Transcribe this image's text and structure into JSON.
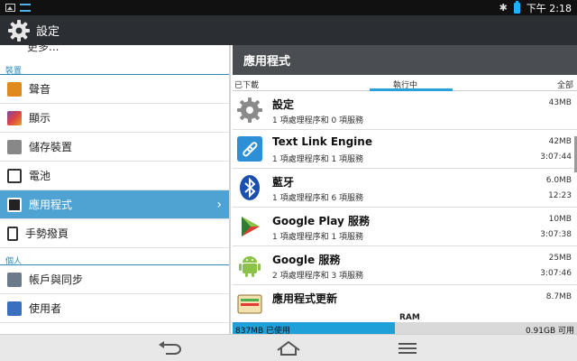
{
  "status_bar": {
    "time": "下午 2:18"
  },
  "action_bar": {
    "title": "設定"
  },
  "left_pane": {
    "cut_item": "更多...",
    "sections": {
      "device": "裝置",
      "personal": "個人"
    },
    "items": [
      {
        "label": "聲音",
        "icon": "sound-icon",
        "color": "#e08a1e"
      },
      {
        "label": "顯示",
        "icon": "display-icon",
        "color": "#7c4aa3"
      },
      {
        "label": "儲存裝置",
        "icon": "storage-icon",
        "color": "#777777"
      },
      {
        "label": "電池",
        "icon": "battery-icon",
        "color": "#333333"
      },
      {
        "label": "應用程式",
        "icon": "apps-icon",
        "color": "#333333"
      },
      {
        "label": "手勢撥頁",
        "icon": "gesture-icon",
        "color": "#333333"
      },
      {
        "label": "帳戶與同步",
        "icon": "accounts-icon",
        "color": "#6b7b8c"
      },
      {
        "label": "使用者",
        "icon": "users-icon",
        "color": "#3a6fbf"
      }
    ]
  },
  "right_pane": {
    "title": "應用程式",
    "tabs": [
      "已下載",
      "執行中",
      "全部"
    ],
    "apps": [
      {
        "name": "設定",
        "desc": "1 項處理程序和 0 項服務",
        "size": "43MB",
        "time": ""
      },
      {
        "name": "Text Link Engine",
        "desc": "1 項處理程序和 1 項服務",
        "size": "42MB",
        "time": "3:07:44"
      },
      {
        "name": "藍牙",
        "desc": "1 項處理程序和 6 項服務",
        "size": "6.0MB",
        "time": "12:23"
      },
      {
        "name": "Google Play 服務",
        "desc": "1 項處理程序和 1 項服務",
        "size": "10MB",
        "time": "3:07:38"
      },
      {
        "name": "Google 服務",
        "desc": "2 項處理程序和 3 項服務",
        "size": "25MB",
        "time": "3:07:46"
      },
      {
        "name": "應用程式更新",
        "desc": "",
        "size": "8.7MB",
        "time": ""
      }
    ]
  },
  "ram": {
    "label": "RAM",
    "used": "837MB 已使用",
    "free": "0.91GB 可用",
    "used_fraction": 0.47
  },
  "colors": {
    "accent": "#4fa3d3",
    "tab_indicator": "#2b9fd8",
    "ram_used": "#1fa0d8"
  }
}
